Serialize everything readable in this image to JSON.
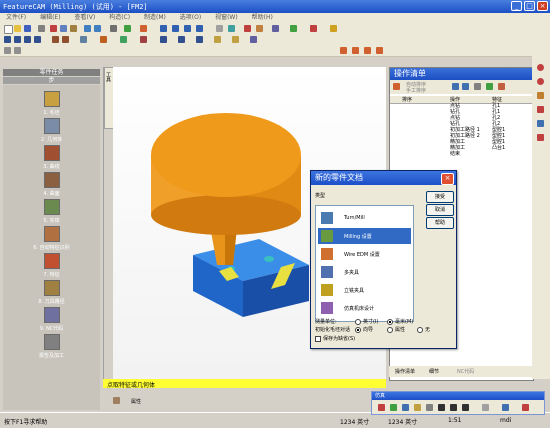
{
  "window": {
    "title": "FeatureCAM (Milling) (试用) - [FM2]"
  },
  "menu": [
    "文件(F)",
    "编辑(E)",
    "查看(V)",
    "构造(C)",
    "制造(M)",
    "选项(O)",
    "视窗(W)",
    "帮助(H)"
  ],
  "left_panel": {
    "title": "零件任务",
    "subtitle": "步",
    "steps": [
      {
        "label": "1. 毛坯",
        "color": "#c8a040"
      },
      {
        "label": "2. 几何体",
        "color": "#7a8ca8"
      },
      {
        "label": "3. 曲线",
        "color": "#a05030"
      },
      {
        "label": "4. 曲面",
        "color": "#8a6040"
      },
      {
        "label": "5. 实体",
        "color": "#6a8a50"
      },
      {
        "label": "6. 自动特征识别",
        "color": "#b07040"
      },
      {
        "label": "7. 特征",
        "color": "#c05030"
      },
      {
        "label": "8. 刀具路径",
        "color": "#a08040"
      },
      {
        "label": "9. NC代码",
        "color": "#7070a0"
      },
      {
        "label": "报告及加工",
        "color": "#808080"
      }
    ]
  },
  "viewport_tab": "工具",
  "status": {
    "prompt": "点取特征或几何体",
    "properties_label": "属性",
    "hint": "按下F1寻求帮助",
    "units": "1234 英寸",
    "units2": "1234 英寸",
    "zoom": "1:51",
    "mode": "mdi"
  },
  "ops": {
    "title": "操作清单",
    "links": [
      "自动排序",
      "手工排序"
    ],
    "columns": [
      "排序",
      "操作",
      "特征"
    ],
    "rows": [
      {
        "op": "点钻",
        "feature": "孔1"
      },
      {
        "op": "钻孔",
        "feature": "孔1"
      },
      {
        "op": "点钻",
        "feature": "孔2"
      },
      {
        "op": "钻孔",
        "feature": "孔2"
      },
      {
        "op": "初加工路径 1",
        "feature": "型腔1"
      },
      {
        "op": "初加工路径 2",
        "feature": "型腔1"
      },
      {
        "op": "精加工",
        "feature": "型腔1"
      },
      {
        "op": "精加工",
        "feature": "凸台1"
      },
      {
        "op": "结束",
        "feature": ""
      }
    ],
    "tabs": [
      "操作清单",
      "细节",
      "NC代码"
    ]
  },
  "dialog": {
    "title": "新的零件文档",
    "type_label": "类型",
    "items": [
      {
        "label": "Turn/Mill",
        "selected": false,
        "color": "#4a7ab0"
      },
      {
        "label": "Milling 设置",
        "selected": true,
        "color": "#6a9a40"
      },
      {
        "label": "Wire EDM 设置",
        "selected": false,
        "color": "#d07030"
      },
      {
        "label": "多夹具",
        "selected": false,
        "color": "#5070b0"
      },
      {
        "label": "立铣夹具",
        "selected": false,
        "color": "#c0a020"
      },
      {
        "label": "仿真机床设计",
        "selected": false,
        "color": "#9060b0"
      }
    ],
    "ok": "接受",
    "cancel": "取消",
    "help": "帮助",
    "units_label": "测量单位:",
    "inch": "英寸(I)",
    "mm": "毫米(M)",
    "init_label": "初始化毛坯对话",
    "wizard": "向导",
    "property": "属性",
    "none": "无",
    "save_default": "保存为缺省(S)"
  },
  "sim": {
    "title": "仿真"
  }
}
